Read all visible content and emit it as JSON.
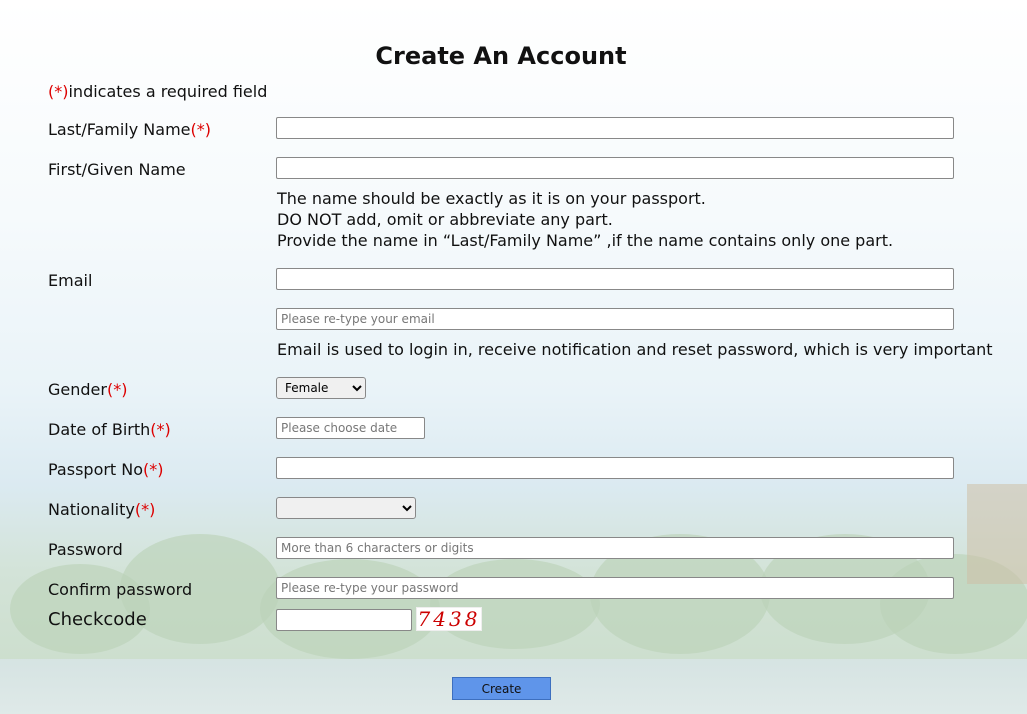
{
  "form": {
    "title": "Create An Account",
    "required_note": "indicates a required field",
    "required_marker": "(*)",
    "last_name": {
      "label": "Last/Family Name",
      "value": ""
    },
    "first_name": {
      "label": "First/Given Name",
      "value": ""
    },
    "name_hint": [
      "The name should be exactly as it is on your passport.",
      "DO NOT add, omit or abbreviate any part.",
      "Provide the name in  “Last/Family Name” ,if the name contains only one part."
    ],
    "email": {
      "label": "Email",
      "value": "",
      "retype_placeholder": "Please re-type your email"
    },
    "email_hint": "Email is used to login in, receive notification and reset password, which is very important",
    "gender": {
      "label": "Gender",
      "selected": "Female"
    },
    "dob": {
      "label": "Date of Birth",
      "placeholder": "Please choose date"
    },
    "passport": {
      "label": "Passport No",
      "value": ""
    },
    "nationality": {
      "label": "Nationality",
      "selected": ""
    },
    "password": {
      "label": "Password",
      "placeholder": "More than 6 characters or digits"
    },
    "confirm_password": {
      "label": "Confirm password",
      "placeholder": "Please re-type your password"
    },
    "checkcode": {
      "label": "Checkcode",
      "value": "",
      "captcha_text": "7438"
    },
    "submit_label": "Create"
  },
  "colors": {
    "required": "#dd0000",
    "button": "#5f95ea",
    "captcha": "#cc0000"
  }
}
